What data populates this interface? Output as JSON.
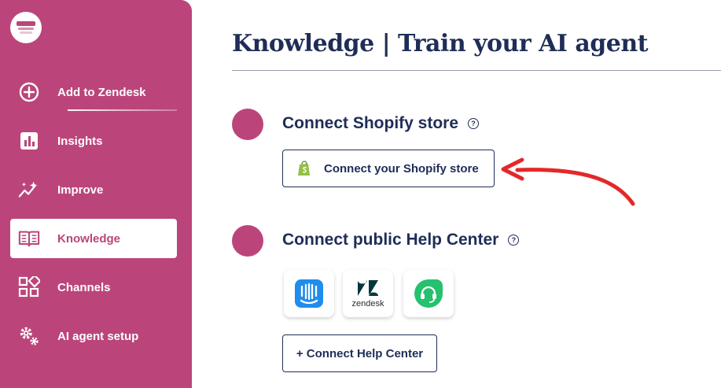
{
  "sidebar": {
    "items": [
      {
        "label": "Add to Zendesk",
        "icon": "plus-circle-icon"
      },
      {
        "label": "Insights",
        "icon": "bar-chart-icon"
      },
      {
        "label": "Improve",
        "icon": "sparkle-trend-icon"
      },
      {
        "label": "Knowledge",
        "icon": "book-icon",
        "active": true
      },
      {
        "label": "Channels",
        "icon": "grid-icon"
      },
      {
        "label": "AI agent setup",
        "icon": "gears-icon"
      }
    ]
  },
  "main": {
    "title": "Knowledge | Train your AI agent",
    "shopify": {
      "heading": "Connect Shopify store",
      "button_label": "Connect your Shopify store"
    },
    "help_center": {
      "heading": "Connect public Help Center",
      "providers": [
        {
          "name": "intercom",
          "icon": "intercom-icon"
        },
        {
          "name": "zendesk",
          "label": "zendesk",
          "icon": "zendesk-icon"
        },
        {
          "name": "freshdesk",
          "icon": "freshdesk-icon"
        }
      ],
      "button_label": "+ Connect Help Center"
    },
    "help_glyph": "?"
  },
  "colors": {
    "brand": "#bb457a",
    "navy": "#1f2d57",
    "shopify_green": "#95bf47",
    "intercom_blue": "#1f8ded",
    "freshdesk_green": "#25c16f",
    "annotation_red": "#e3282b"
  }
}
